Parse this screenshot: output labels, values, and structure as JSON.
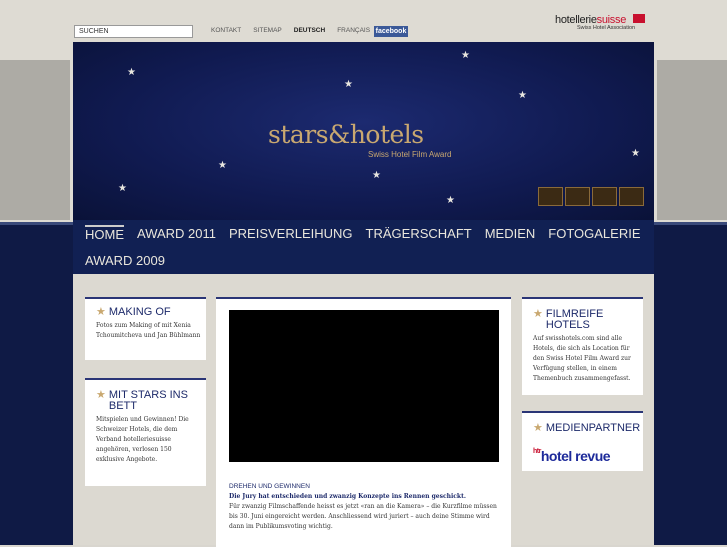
{
  "search": {
    "value": "SUCHEN"
  },
  "toplinks": [
    "KONTAKT",
    "SITEMAP",
    "DEUTSCH",
    "FRANÇAIS"
  ],
  "facebook": "facebook",
  "logo": {
    "part1": "hotellerie",
    "part2": "suisse",
    "sub": "Swiss Hotel Association"
  },
  "banner": {
    "brand": "stars&hotels",
    "sub": "Swiss Hotel Film Award"
  },
  "nav": {
    "row1": [
      "HOME",
      "AWARD 2011",
      "PREISVERLEIHUNG",
      "TRÄGERSCHAFT",
      "MEDIEN",
      "FOTOGALERIE"
    ],
    "row2": [
      "AWARD 2009"
    ]
  },
  "boxes": {
    "making_of": {
      "title": "MAKING OF",
      "text": "Fotos zum Making of mit Xenia Tchoumitcheva und Jan Bühlmann"
    },
    "mit_stars": {
      "title": "MIT STARS INS BETT",
      "text": "Mitspielen und Gewinnen! Die Schweizer Hotels, die dem Verband hotelleriesuisse angehören, verlosen 150 exklusive Angebote."
    },
    "filmreife": {
      "title": "FILMREIFE HOTELS",
      "text": "Auf swisshotels.com sind alle Hotels, die sich als Location für den Swiss Hotel Film Award zur Verfügung stellen, in einem Themenbuch zusammengefasst."
    },
    "medienpartner": {
      "title": "MEDIENPARTNER",
      "logo_prefix": "htr",
      "logo_text": "hotel revue"
    }
  },
  "main": {
    "heading": "DREHEN UND GEWINNEN",
    "lead": "Die Jury hat entschieden und zwanzig Konzepte ins Rennen geschickt.",
    "body": "Für zwanzig Filmschaffende heisst es jetzt «ran an die Kamera» – die Kurzfilme müssen bis 30. Juni eingereicht werden. Anschliessend wird juriert – auch deine Stimme wird dann im Publikumsvoting wichtig."
  },
  "colors": {
    "navy": "#112053",
    "gold": "#c9a870",
    "accent": "#c8102e"
  }
}
